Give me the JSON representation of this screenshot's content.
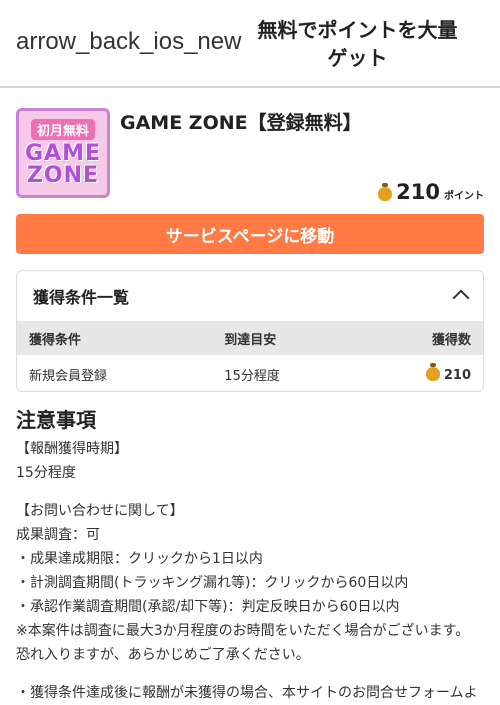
{
  "header": {
    "back": "arrow_back_ios_new",
    "title": "無料でポイントを大量ゲット"
  },
  "service": {
    "logo_top": "初月無料",
    "logo_word1": "GAME",
    "logo_word2": "ZONE",
    "name": "GAME ZONE【登録無料】",
    "points": "210",
    "points_unit": "ポイント",
    "cta_label": "サービスページに移動"
  },
  "conditions": {
    "heading": "獲得条件一覧",
    "columns": [
      "獲得条件",
      "到達目安",
      "獲得数"
    ],
    "rows": [
      {
        "condition": "新規会員登録",
        "eta": "15分程度",
        "points": "210"
      }
    ]
  },
  "notes": {
    "heading": "注意事項",
    "lines_block1": [
      "【報酬獲得時期】",
      "15分程度"
    ],
    "lines_block2": [
      "【お問い合わせに関して】",
      "成果調査：可",
      "・成果達成期限：クリックから1日以内",
      "・計測調査期間(トラッキング漏れ等)：クリックから60日以内",
      "・承認作業調査期間(承認/却下等)：判定反映日から60日以内",
      "※本案件は調査に最大3か月程度のお時間をいただく場合がございます。",
      "恐れ入りますが、あらかじめご了承ください。"
    ],
    "line_block3": "・獲得条件達成後に報酬が未獲得の場合、本サイトのお問合せフォームよ"
  },
  "colors": {
    "accent": "#ff7a45",
    "coin": "#e4a021"
  }
}
